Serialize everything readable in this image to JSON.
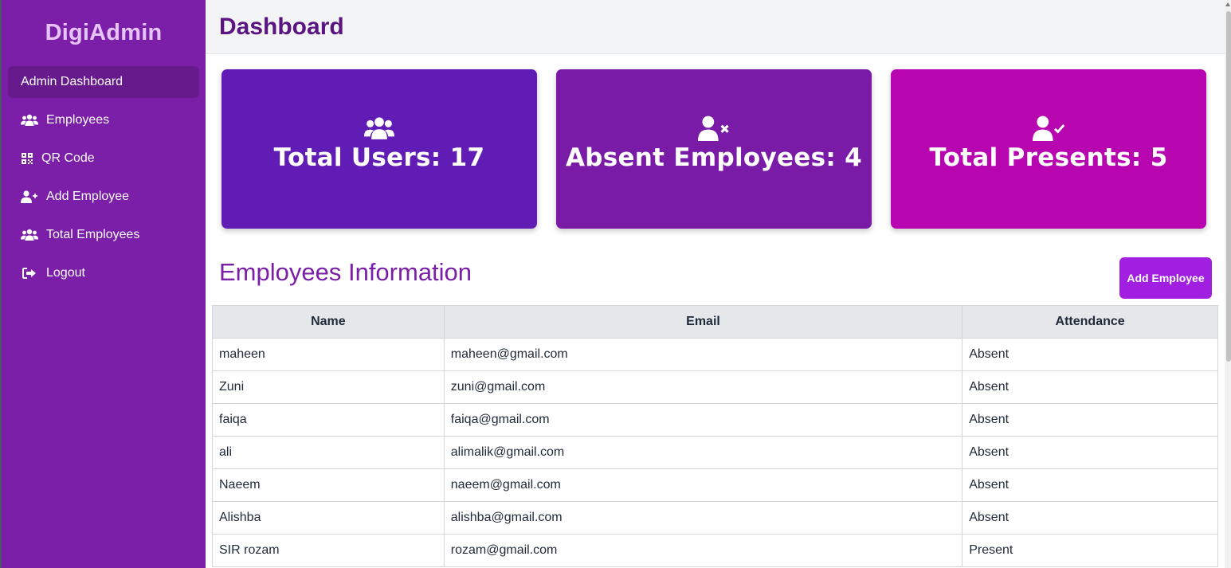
{
  "sidebar": {
    "brand": "DigiAdmin",
    "items": [
      {
        "label": "Admin Dashboard",
        "icon": "none"
      },
      {
        "label": "Employees",
        "icon": "users-icon"
      },
      {
        "label": "QR Code",
        "icon": "qrcode-icon"
      },
      {
        "label": "Add Employee",
        "icon": "user-plus-icon"
      },
      {
        "label": "Total Employees",
        "icon": "users-icon"
      },
      {
        "label": "Logout",
        "icon": "logout-icon"
      }
    ]
  },
  "header": {
    "title": "Dashboard"
  },
  "cards": [
    {
      "label": "Total Users: 17",
      "icon": "users-icon",
      "color": "#611cb6"
    },
    {
      "label": "Absent Employees: 4",
      "icon": "user-x-icon",
      "color": "#7a1ba8"
    },
    {
      "label": "Total Presents: 5",
      "icon": "user-check-icon",
      "color": "#b705b0"
    }
  ],
  "section": {
    "title": "Employees Information",
    "add_button": "Add Employee"
  },
  "table": {
    "headers": [
      "Name",
      "Email",
      "Attendance"
    ],
    "rows": [
      [
        "maheen",
        "maheen@gmail.com",
        "Absent"
      ],
      [
        "Zuni",
        "zuni@gmail.com",
        "Absent"
      ],
      [
        "faiqa",
        "faiqa@gmail.com",
        "Absent"
      ],
      [
        "ali",
        "alimalik@gmail.com",
        "Absent"
      ],
      [
        "Naeem",
        "naeem@gmail.com",
        "Absent"
      ],
      [
        "Alishba",
        "alishba@gmail.com",
        "Absent"
      ],
      [
        "SIR rozam",
        "rozam@gmail.com",
        "Present"
      ]
    ]
  },
  "colors": {
    "sidebar": "#7b1ea8",
    "title": "#5b1580",
    "button": "#a11fe0"
  }
}
